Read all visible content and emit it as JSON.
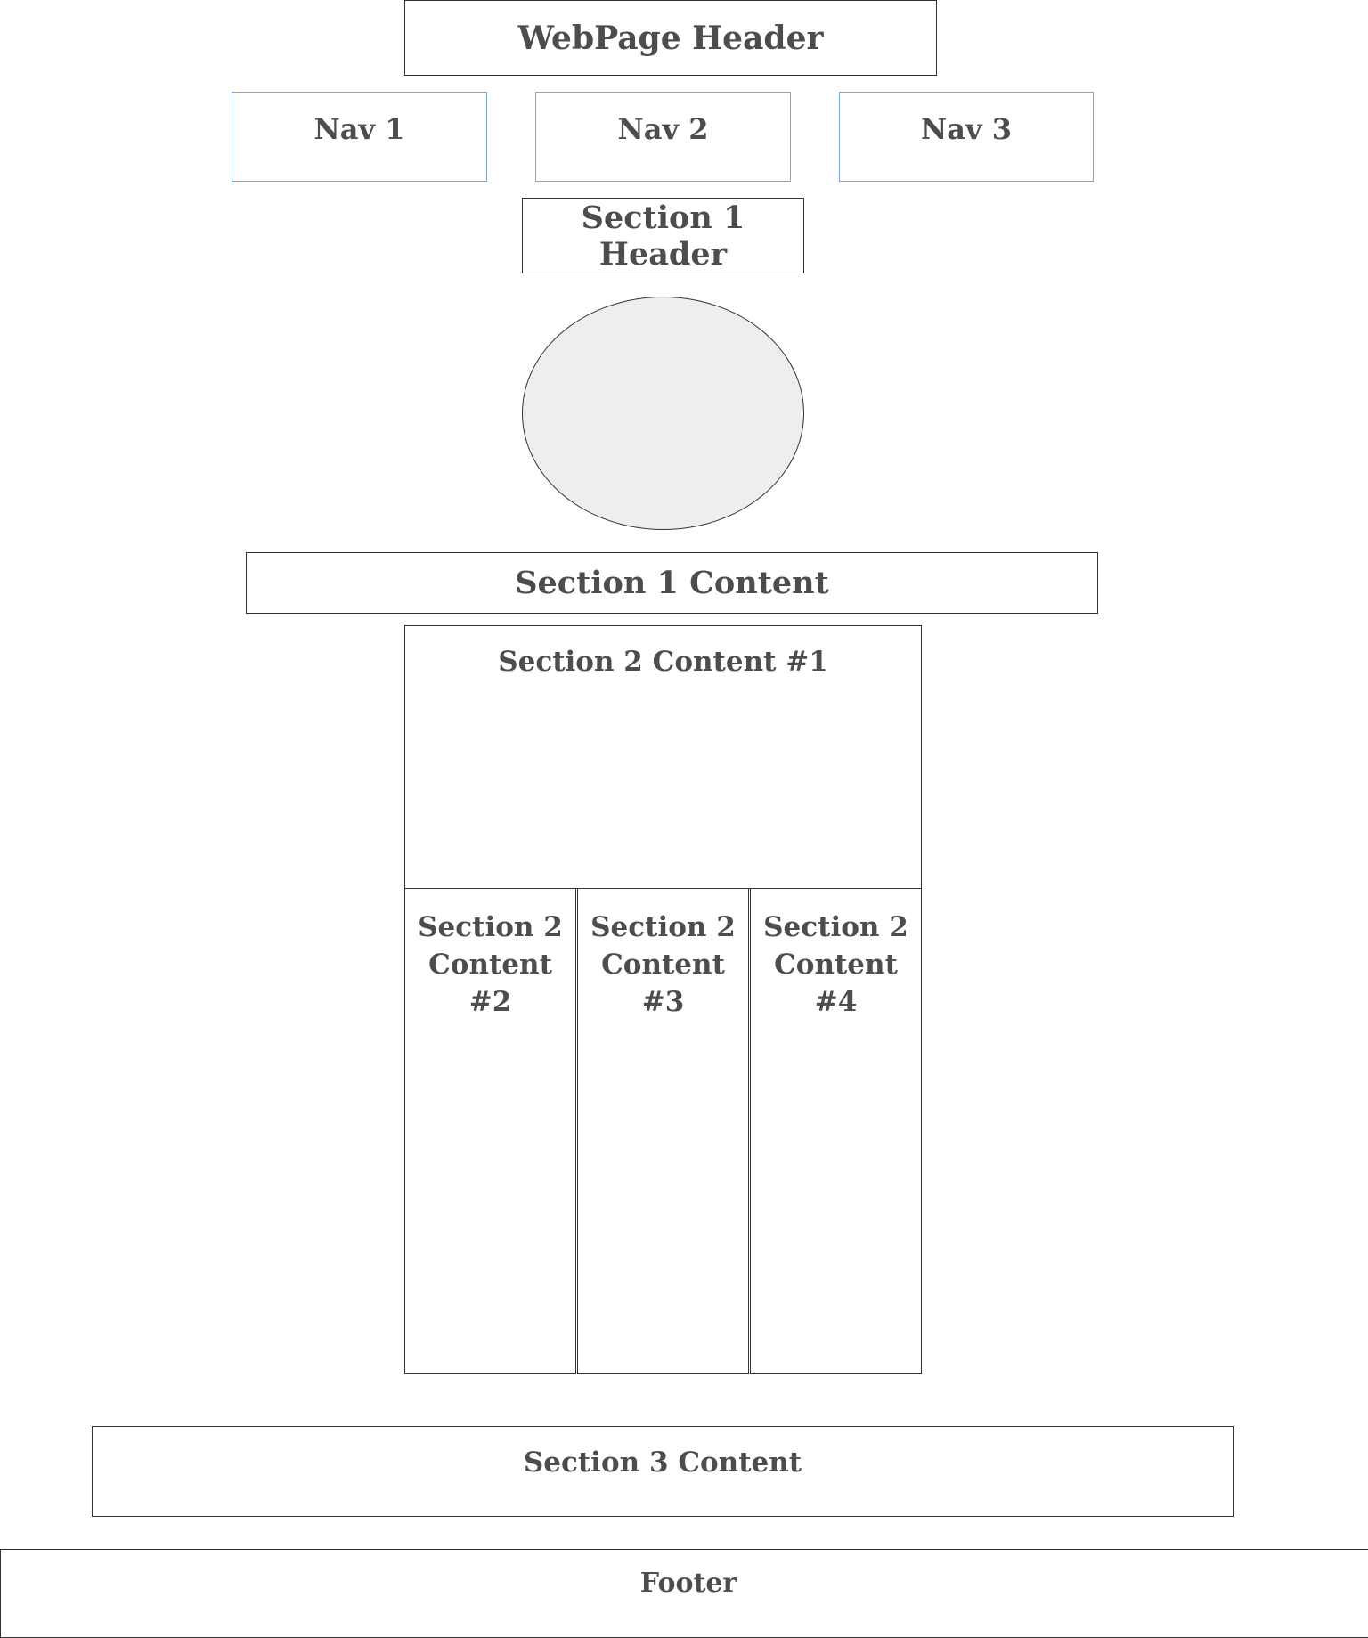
{
  "header": {
    "label": "WebPage Header"
  },
  "nav": [
    {
      "label": "Nav 1"
    },
    {
      "label": "Nav 2"
    },
    {
      "label": "Nav 3"
    }
  ],
  "section1": {
    "header_label": "Section 1 Header",
    "content_label": "Section 1 Content"
  },
  "section2": {
    "content1_label": "Section 2 Content #1",
    "columns": [
      {
        "line1": "Section 2",
        "line2": "Content",
        "line3": "#2"
      },
      {
        "line1": "Section 2",
        "line2": "Content",
        "line3": "#3"
      },
      {
        "line1": "Section 2",
        "line2": "Content",
        "line3": "#4"
      }
    ]
  },
  "section3": {
    "content_label": "Section 3 Content"
  },
  "footer": {
    "label": "Footer"
  },
  "colors": {
    "border": "#333333",
    "nav_border": "#7ea6e0",
    "ellipse_fill": "#eeeeee",
    "text": "#4d4d4d"
  }
}
